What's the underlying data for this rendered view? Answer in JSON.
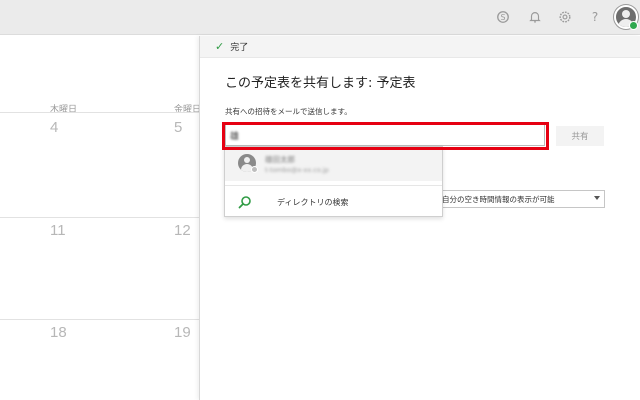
{
  "top_bar": {
    "icons": [
      "skype-icon",
      "bell-icon",
      "gear-icon",
      "help-icon",
      "user-avatar"
    ],
    "help_glyph": "?"
  },
  "calendar": {
    "day_headers": [
      "木曜日",
      "金曜日"
    ],
    "dates": [
      "4",
      "5",
      "11",
      "12",
      "18",
      "19"
    ]
  },
  "share_panel": {
    "done_label": "完了",
    "title": "この予定表を共有します: 予定表",
    "subtitle": "共有への招待をメールで送信します。",
    "invite_value": "雄",
    "share_button": "共有",
    "permission_selected": "自分の空き時間情報の表示が可能",
    "suggestion": {
      "name": "雄田太郎",
      "email": "t-tombo@x-xx.co.jp"
    },
    "directory_search": "ディレクトリの検索"
  },
  "colors": {
    "highlight": "#e60012",
    "check": "#2f9b44",
    "search_icon": "#2f9b44"
  }
}
